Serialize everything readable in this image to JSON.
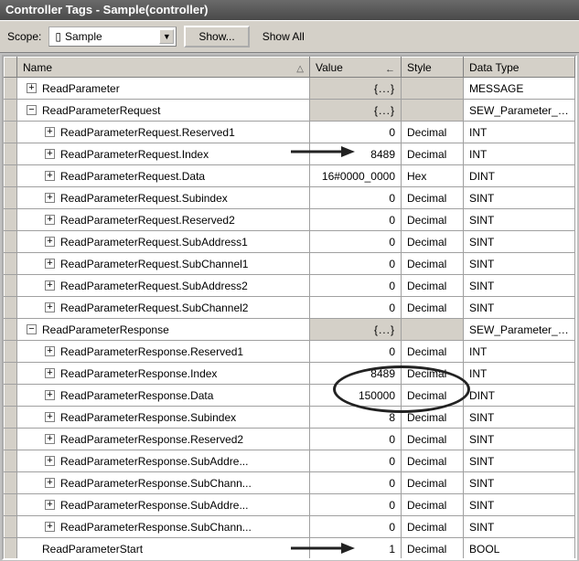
{
  "title": "Controller Tags - Sample(controller)",
  "toolbar": {
    "scope_label": "Scope:",
    "scope_value": "Sample",
    "show_btn": "Show...",
    "show_all": "Show All"
  },
  "columns": {
    "name": "Name",
    "value": "Value",
    "style": "Style",
    "datatype": "Data Type"
  },
  "struct_placeholder": "{...}",
  "rows": [
    {
      "indent": 0,
      "exp": "+",
      "name": "ReadParameter",
      "value": "{...}",
      "is_struct": true,
      "style": "",
      "type": "MESSAGE"
    },
    {
      "indent": 0,
      "exp": "−",
      "name": "ReadParameterRequest",
      "value": "{...}",
      "is_struct": true,
      "style": "",
      "type": "SEW_Parameter_Channel"
    },
    {
      "indent": 1,
      "exp": "+",
      "name": "ReadParameterRequest.Reserved1",
      "value": "0",
      "is_struct": false,
      "style": "Decimal",
      "type": "INT"
    },
    {
      "indent": 1,
      "exp": "+",
      "name": "ReadParameterRequest.Index",
      "value": "8489",
      "is_struct": false,
      "style": "Decimal",
      "type": "INT"
    },
    {
      "indent": 1,
      "exp": "+",
      "name": "ReadParameterRequest.Data",
      "value": "16#0000_0000",
      "is_struct": false,
      "style": "Hex",
      "type": "DINT"
    },
    {
      "indent": 1,
      "exp": "+",
      "name": "ReadParameterRequest.Subindex",
      "value": "0",
      "is_struct": false,
      "style": "Decimal",
      "type": "SINT"
    },
    {
      "indent": 1,
      "exp": "+",
      "name": "ReadParameterRequest.Reserved2",
      "value": "0",
      "is_struct": false,
      "style": "Decimal",
      "type": "SINT"
    },
    {
      "indent": 1,
      "exp": "+",
      "name": "ReadParameterRequest.SubAddress1",
      "value": "0",
      "is_struct": false,
      "style": "Decimal",
      "type": "SINT"
    },
    {
      "indent": 1,
      "exp": "+",
      "name": "ReadParameterRequest.SubChannel1",
      "value": "0",
      "is_struct": false,
      "style": "Decimal",
      "type": "SINT"
    },
    {
      "indent": 1,
      "exp": "+",
      "name": "ReadParameterRequest.SubAddress2",
      "value": "0",
      "is_struct": false,
      "style": "Decimal",
      "type": "SINT"
    },
    {
      "indent": 1,
      "exp": "+",
      "name": "ReadParameterRequest.SubChannel2",
      "value": "0",
      "is_struct": false,
      "style": "Decimal",
      "type": "SINT"
    },
    {
      "indent": 0,
      "exp": "−",
      "name": "ReadParameterResponse",
      "value": "{...}",
      "is_struct": true,
      "style": "",
      "type": "SEW_Parameter_Channel"
    },
    {
      "indent": 1,
      "exp": "+",
      "name": "ReadParameterResponse.Reserved1",
      "value": "0",
      "is_struct": false,
      "style": "Decimal",
      "type": "INT"
    },
    {
      "indent": 1,
      "exp": "+",
      "name": "ReadParameterResponse.Index",
      "value": "8489",
      "is_struct": false,
      "style": "Decimal",
      "type": "INT"
    },
    {
      "indent": 1,
      "exp": "+",
      "name": "ReadParameterResponse.Data",
      "value": "150000",
      "is_struct": false,
      "style": "Decimal",
      "type": "DINT"
    },
    {
      "indent": 1,
      "exp": "+",
      "name": "ReadParameterResponse.Subindex",
      "value": "8",
      "is_struct": false,
      "style": "Decimal",
      "type": "SINT"
    },
    {
      "indent": 1,
      "exp": "+",
      "name": "ReadParameterResponse.Reserved2",
      "value": "0",
      "is_struct": false,
      "style": "Decimal",
      "type": "SINT"
    },
    {
      "indent": 1,
      "exp": "+",
      "name": "ReadParameterResponse.SubAddre...",
      "value": "0",
      "is_struct": false,
      "style": "Decimal",
      "type": "SINT"
    },
    {
      "indent": 1,
      "exp": "+",
      "name": "ReadParameterResponse.SubChann...",
      "value": "0",
      "is_struct": false,
      "style": "Decimal",
      "type": "SINT"
    },
    {
      "indent": 1,
      "exp": "+",
      "name": "ReadParameterResponse.SubAddre...",
      "value": "0",
      "is_struct": false,
      "style": "Decimal",
      "type": "SINT"
    },
    {
      "indent": 1,
      "exp": "+",
      "name": "ReadParameterResponse.SubChann...",
      "value": "0",
      "is_struct": false,
      "style": "Decimal",
      "type": "SINT"
    },
    {
      "indent": 0,
      "exp": "",
      "name": "ReadParameterStart",
      "value": "1",
      "is_struct": false,
      "style": "Decimal",
      "type": "BOOL"
    }
  ]
}
